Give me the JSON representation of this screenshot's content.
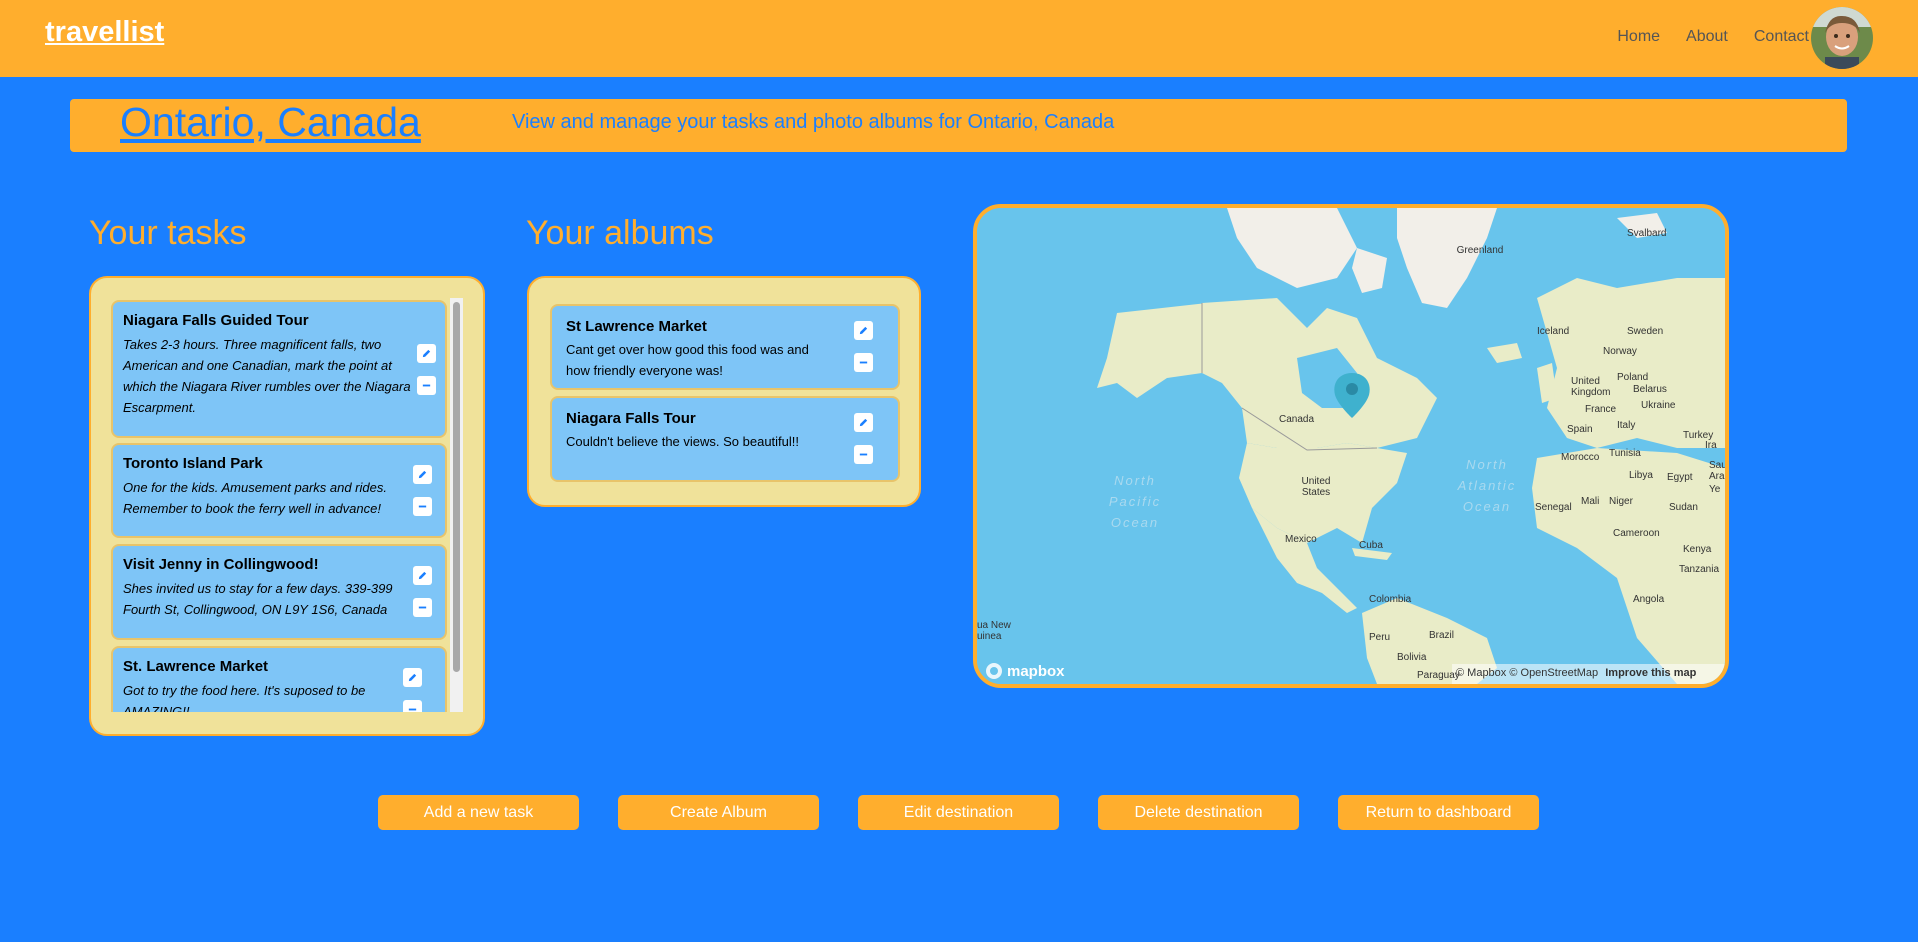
{
  "navbar": {
    "brand": "travellist",
    "links": [
      "Home",
      "About",
      "Contact"
    ]
  },
  "banner": {
    "title": "Ontario, Canada",
    "subtitle": "View and manage your tasks and photo albums for Ontario, Canada"
  },
  "tasks": {
    "heading": "Your tasks",
    "items": [
      {
        "title": "Niagara Falls Guided Tour",
        "lines": [
          "Takes 2-3 hours. Three magnificent falls, two",
          "American and one Canadian, mark the point at",
          "which the Niagara River rumbles over the Niagara",
          "Escarpment."
        ]
      },
      {
        "title": "Toronto Island Park",
        "lines": [
          "One for the kids. Amusement parks and rides.",
          "Remember to book the ferry well in advance!"
        ]
      },
      {
        "title": "Visit Jenny in Collingwood!",
        "lines": [
          "Shes invited us to stay for a few days. 339-399",
          "Fourth St, Collingwood, ON L9Y 1S6, Canada"
        ]
      },
      {
        "title": "St. Lawrence Market",
        "lines": [
          "Got to try the food here. It's suposed to be",
          "AMAZING!!"
        ]
      }
    ]
  },
  "albums": {
    "heading": "Your albums",
    "items": [
      {
        "title": "St Lawrence Market",
        "lines": [
          "Cant get over how good this food was and",
          "how friendly everyone was!"
        ]
      },
      {
        "title": "Niagara Falls Tour",
        "lines": [
          "Couldn't believe the views. So beautiful!!"
        ]
      }
    ]
  },
  "map": {
    "labels": {
      "greenland": "Greenland",
      "svalbard": "Svalbard",
      "iceland": "Iceland",
      "sweden": "Sweden",
      "norway": "Norway",
      "united_kingdom": "United Kingdom",
      "belarus": "Belarus",
      "poland": "Poland",
      "ukraine": "Ukraine",
      "france": "France",
      "spain": "Spain",
      "italy": "Italy",
      "turkey": "Turkey",
      "morocco": "Morocco",
      "tunisia": "Tunisia",
      "libya": "Libya",
      "egypt": "Egypt",
      "mali": "Mali",
      "niger": "Niger",
      "senegal": "Senegal",
      "sudan": "Sudan",
      "cameroon": "Cameroon",
      "kenya": "Kenya",
      "tanzania": "Tanzania",
      "angola": "Angola",
      "canada": "Canada",
      "united_states": "United States",
      "mexico": "Mexico",
      "cuba": "Cuba",
      "colombia": "Colombia",
      "peru": "Peru",
      "brazil": "Brazil",
      "bolivia": "Bolivia",
      "paraguay": "Paraguay",
      "png": "ua New uinea",
      "north_pacific": "North Pacific Ocean",
      "north_atlantic": "North Atlantic Ocean",
      "iraq": "Ira",
      "saudi": "Sau Ara",
      "yemen": "Ye"
    },
    "logo": "mapbox",
    "attribution": "© Mapbox © OpenStreetMap",
    "improve": "Improve this map"
  },
  "actions": [
    "Add a new task",
    "Create Album",
    "Edit destination",
    "Delete destination",
    "Return to dashboard"
  ],
  "colors": {
    "background": "#1a7fff",
    "accent": "#ffae2d",
    "panel": "#f0e29a",
    "card": "#7ec5f7"
  }
}
